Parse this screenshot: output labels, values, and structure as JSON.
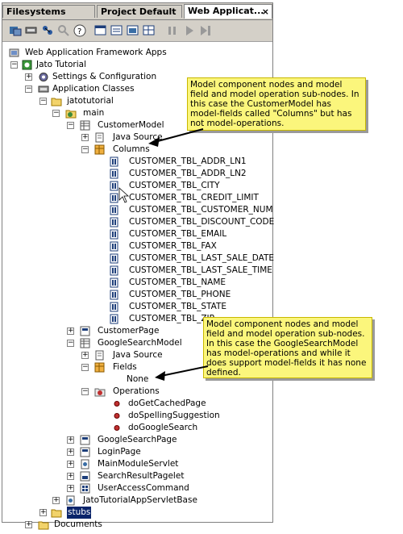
{
  "tabs": [
    "Filesystems",
    "Project Default",
    "Web Applicat..."
  ],
  "tab_close": "×",
  "toolbar": {
    "icons": [
      "explore-icon",
      "mount-icon",
      "network-icon",
      "search-icon",
      "help-icon",
      "view-icon",
      "list-icon",
      "table-icon",
      "grid-icon",
      "step-icon",
      "run-icon",
      "run-to-icon"
    ]
  },
  "tree": {
    "root": "Web Application Framework Apps",
    "jato": "Jato Tutorial",
    "settings": "Settings & Configuration",
    "app_classes": "Application Classes",
    "jatotutorial": "jatotutorial",
    "main": "main",
    "customer_model": "CustomerModel",
    "java_source": "Java Source",
    "columns": "Columns",
    "column_items": [
      "CUSTOMER_TBL_ADDR_LN1",
      "CUSTOMER_TBL_ADDR_LN2",
      "CUSTOMER_TBL_CITY",
      "CUSTOMER_TBL_CREDIT_LIMIT",
      "CUSTOMER_TBL_CUSTOMER_NUM",
      "CUSTOMER_TBL_DISCOUNT_CODE",
      "CUSTOMER_TBL_EMAIL",
      "CUSTOMER_TBL_FAX",
      "CUSTOMER_TBL_LAST_SALE_DATE",
      "CUSTOMER_TBL_LAST_SALE_TIME",
      "CUSTOMER_TBL_NAME",
      "CUSTOMER_TBL_PHONE",
      "CUSTOMER_TBL_STATE",
      "CUSTOMER_TBL_ZIP"
    ],
    "customer_page": "CustomerPage",
    "google_model": "GoogleSearchModel",
    "java_source2": "Java Source",
    "fields": "Fields",
    "none": "None",
    "operations": "Operations",
    "operation_items": [
      "doGetCachedPage",
      "doSpellingSuggestion",
      "doGoogleSearch"
    ],
    "google_page": "GoogleSearchPage",
    "login_page": "LoginPage",
    "main_servlet": "MainModuleServlet",
    "search_pagelet": "SearchResultPagelet",
    "user_access": "UserAccessCommand",
    "servlet_base": "JatoTutorialAppServletBase",
    "stubs": "stubs",
    "documents": "Documents"
  },
  "notes": {
    "note1": "Model component nodes and model field and model operation sub-nodes. In this case the CustomerModel has model-fields called \"Columns\" but has not model-operations.",
    "note2": "Model component nodes and model field and model operation sub-nodes. In this case the GoogleSearchModel has model-operations and while it does support model-fields it has none defined."
  },
  "colors": {
    "note_bg": "#fbf67c",
    "selection": "#0a246a",
    "chrome": "#d4d0c8"
  }
}
